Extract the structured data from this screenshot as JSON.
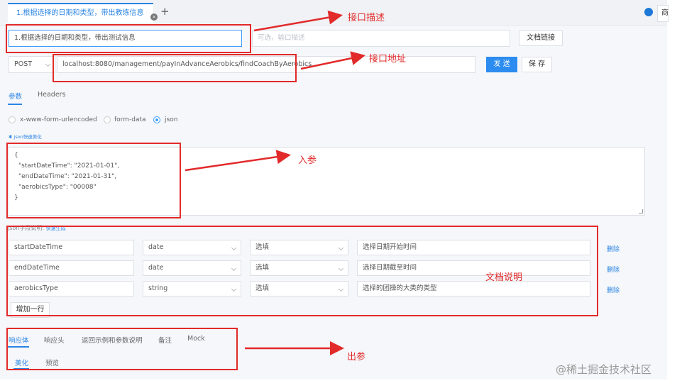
{
  "tab": {
    "title": "1.根据选择的日期和类型，带出教练信息",
    "close_icon": "close-icon",
    "add_label": "+"
  },
  "header_right": {
    "globe_icon": "globe-icon",
    "corner_label": "商"
  },
  "desc_input": {
    "value": "1.根据选择的日期和类型，带出测试信息"
  },
  "remark_input": {
    "placeholder": "可选，输口描述"
  },
  "doc_link_button": "文档链接",
  "method": {
    "value": "POST"
  },
  "url_input": {
    "value": "localhost:8080/management/payInAdvanceAerobics/findCoachByAerobics"
  },
  "send_button": "发 送",
  "save_button": "保 存",
  "req_tabs": [
    {
      "label": "参数"
    },
    {
      "label": "Headers"
    }
  ],
  "body_types": [
    {
      "label": "x-www-form-urlencoded"
    },
    {
      "label": "form-data"
    },
    {
      "label": "json"
    }
  ],
  "json_beautify_link": "✱ json快速美化",
  "json_body": {
    "lines": [
      "{",
      "\"startDateTime\": \"2021-01-01\",",
      "\"endDateTime\": \"2021-01-31\",",
      "\"aerobicsType\": \"00008\"",
      "}"
    ]
  },
  "doc_section": {
    "label": "json字段说明:",
    "link": "快速生成"
  },
  "params": [
    {
      "name": "startDateTime",
      "type": "date",
      "required": "选填",
      "desc": "选择日期开始时间",
      "delete": "删除"
    },
    {
      "name": "endDateTime",
      "type": "date",
      "required": "选填",
      "desc": "选择日期截至时间",
      "delete": "删除"
    },
    {
      "name": "aerobicsType",
      "type": "string",
      "required": "选填",
      "desc": "选择的团操的大类的类型",
      "delete": "删除"
    }
  ],
  "add_row_button": "增加一行",
  "resp_tabs": [
    {
      "label": "响应体"
    },
    {
      "label": "响应头"
    },
    {
      "label": "返回示例和参数说明"
    },
    {
      "label": "备注"
    },
    {
      "label": "Mock"
    }
  ],
  "resp_subtabs": [
    {
      "label": "美化"
    },
    {
      "label": "预览"
    }
  ],
  "annotations": {
    "api_desc": "接口描述",
    "api_url": "接口地址",
    "input_params": "入参",
    "doc": "文档说明",
    "output_params": "出参",
    "color": "#e22a2a"
  },
  "watermark": "@稀土掘金技术社区"
}
